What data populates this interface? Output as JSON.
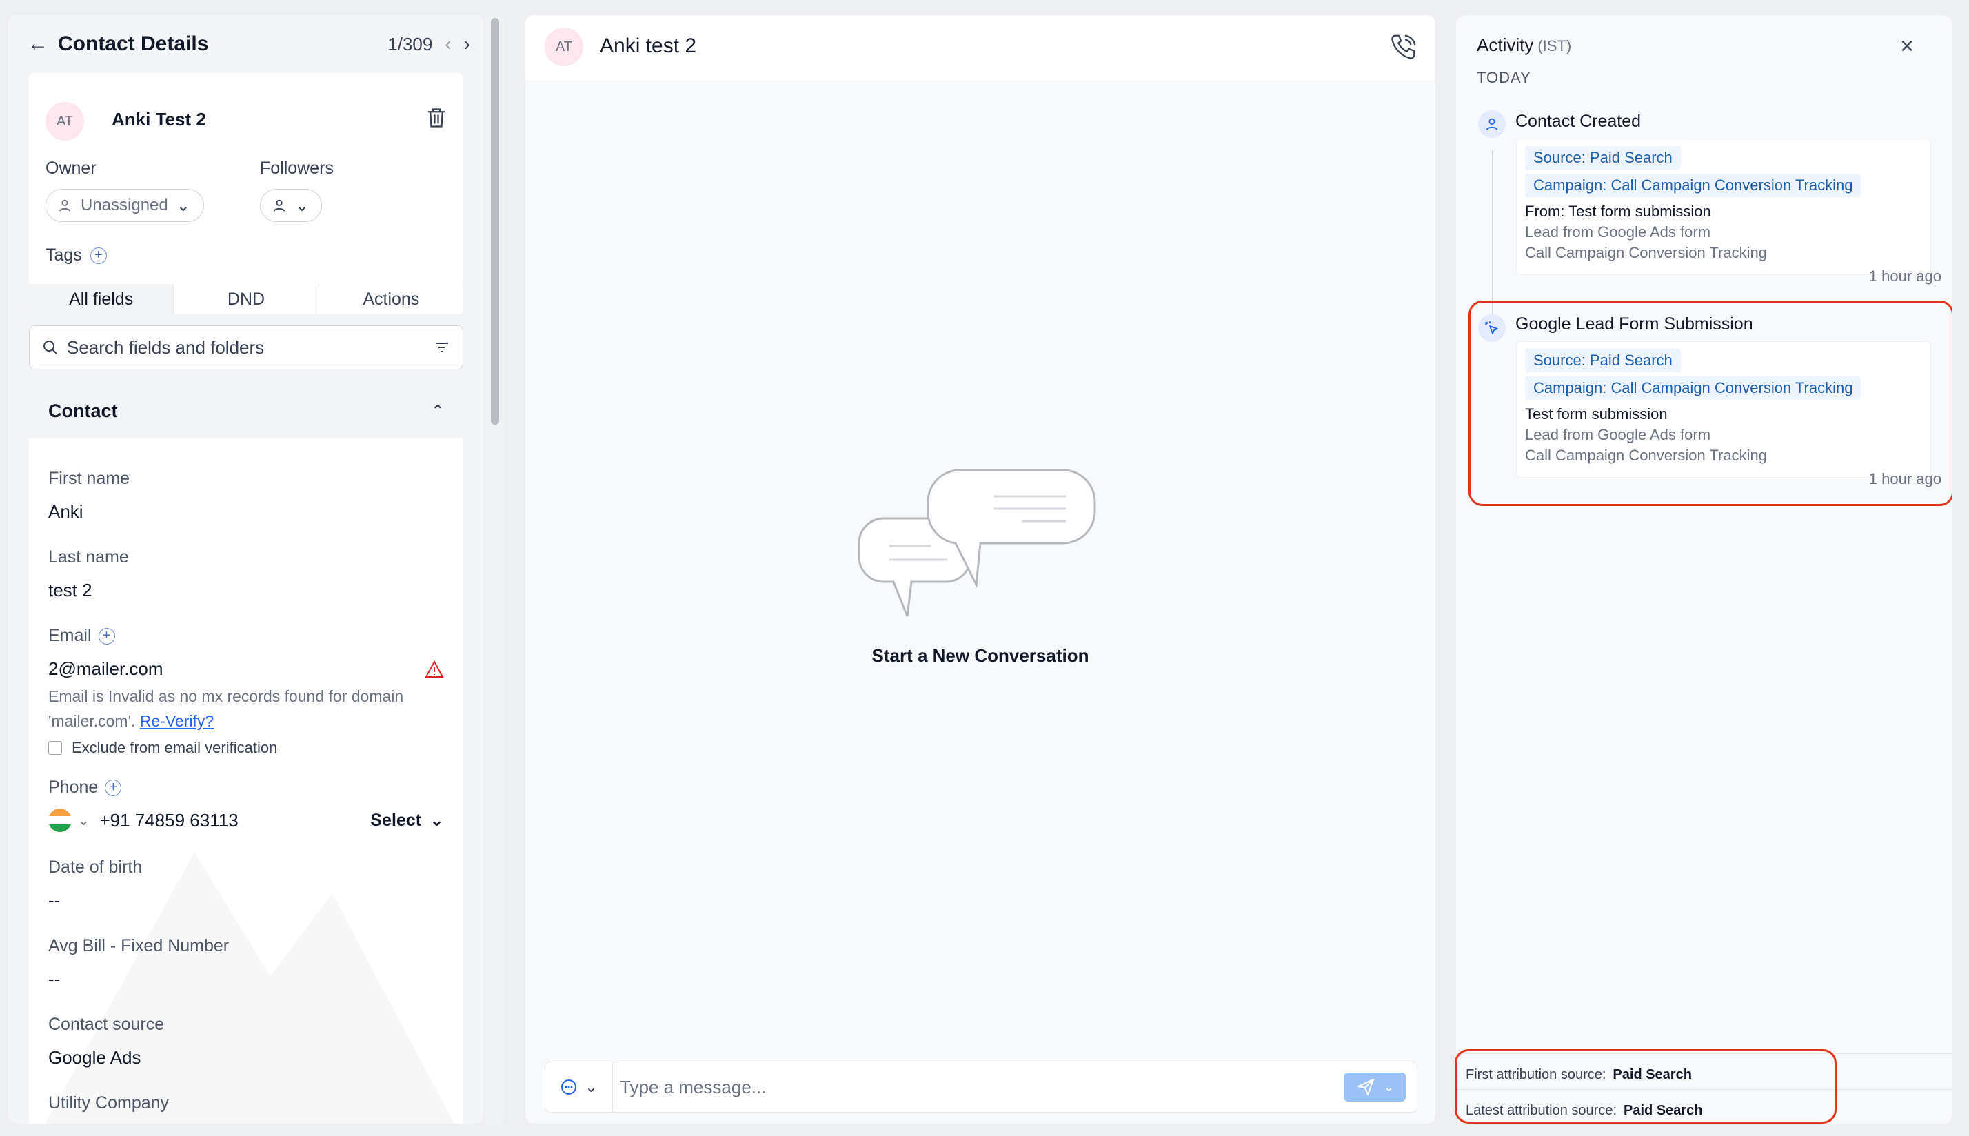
{
  "left": {
    "title": "Contact Details",
    "pager": "1/309",
    "contact": {
      "initials": "AT",
      "name": "Anki Test 2"
    },
    "owner_label": "Owner",
    "owner_value": "Unassigned",
    "followers_label": "Followers",
    "tags_label": "Tags",
    "tabs": [
      "All fields",
      "DND",
      "Actions"
    ],
    "search_placeholder": "Search fields and folders",
    "section_title": "Contact",
    "fields": {
      "first_name": {
        "label": "First name",
        "value": "Anki"
      },
      "last_name": {
        "label": "Last name",
        "value": "test 2"
      },
      "email": {
        "label": "Email",
        "value": "2@mailer.com",
        "error": "Email is Invalid as no mx records found for domain 'mailer.com'.",
        "reverify": "Re-Verify?",
        "exclude": "Exclude from email verification"
      },
      "phone": {
        "label": "Phone",
        "value": "+91 74859 63113",
        "type_select": "Select"
      },
      "dob": {
        "label": "Date of birth",
        "value": "--"
      },
      "avg_bill": {
        "label": "Avg Bill - Fixed Number",
        "value": "--"
      },
      "contact_source": {
        "label": "Contact source",
        "value": "Google Ads"
      },
      "utility": {
        "label": "Utility Company",
        "value": "--"
      }
    }
  },
  "middle": {
    "initials": "AT",
    "name": "Anki test 2",
    "empty_text": "Start a New Conversation",
    "composer_placeholder": "Type a message..."
  },
  "right": {
    "title": "Activity",
    "timezone": "(IST)",
    "day": "TODAY",
    "events": [
      {
        "title": "Contact Created",
        "source": "Source: Paid Search",
        "campaign": "Campaign: Call Campaign Conversion Tracking",
        "line1": "From: Test form submission",
        "line2": "Lead from Google Ads form",
        "line3": "Call Campaign Conversion Tracking",
        "time": "1 hour ago"
      },
      {
        "title": "Google Lead Form Submission",
        "source": "Source: Paid Search",
        "campaign": "Campaign: Call Campaign Conversion Tracking",
        "line1": "Test form submission",
        "line2": "Lead from Google Ads form",
        "line3": "Call Campaign Conversion Tracking",
        "time": "1 hour ago"
      }
    ],
    "attribution": {
      "first_label": "First attribution source:",
      "first_value": "Paid Search",
      "latest_label": "Latest attribution source:",
      "latest_value": "Paid Search"
    }
  },
  "colors": {
    "accent": "#2563eb",
    "highlight": "#e0341f",
    "chip_text": "#1d5fa8",
    "warning": "#dc2626"
  }
}
